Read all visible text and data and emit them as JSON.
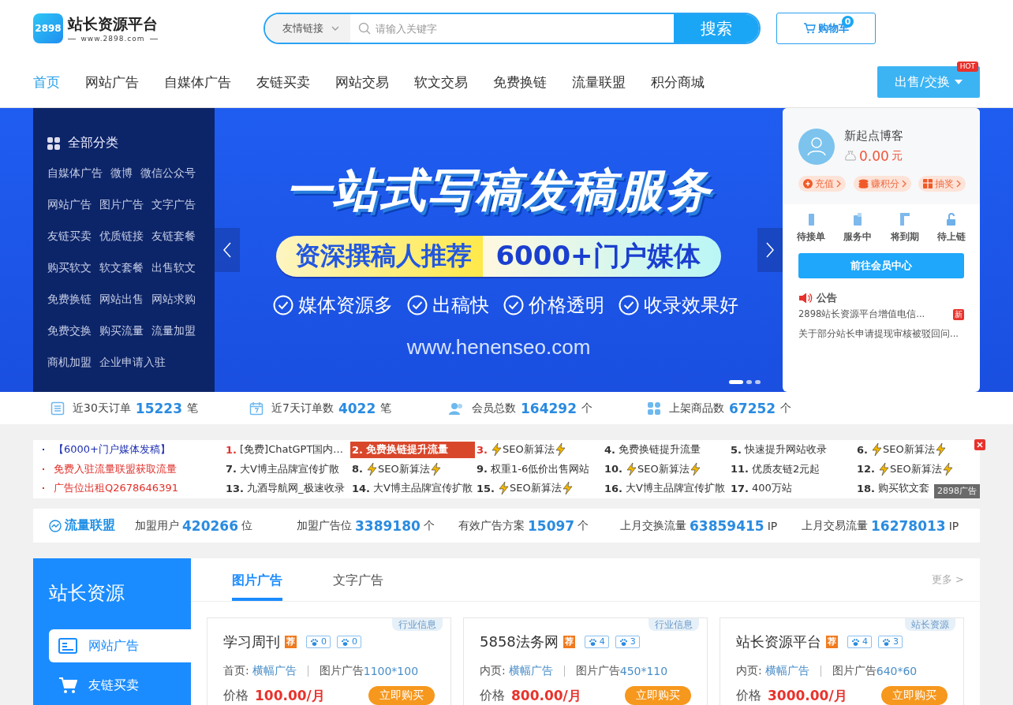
{
  "header": {
    "logo": {
      "badge": "2898",
      "name": "站长资源平台",
      "url": "www.2898.com"
    },
    "search": {
      "category": "友情链接",
      "placeholder": "请输入关键字",
      "button": "搜索"
    },
    "cart": {
      "label": "购物车",
      "count": "0"
    }
  },
  "nav": {
    "items": [
      {
        "label": "首页",
        "selected": true
      },
      {
        "label": "网站广告",
        "selected": false
      },
      {
        "label": "自媒体广告",
        "selected": false
      },
      {
        "label": "友链买卖",
        "selected": false
      },
      {
        "label": "网站交易",
        "selected": false
      },
      {
        "label": "软文交易",
        "selected": false
      },
      {
        "label": "免费换链",
        "selected": false
      },
      {
        "label": "流量联盟",
        "selected": false
      },
      {
        "label": "积分商城",
        "selected": false
      }
    ],
    "action": {
      "label": "出售/交换",
      "badge": "HOT"
    }
  },
  "categories": {
    "title": "全部分类",
    "rows": [
      [
        "自媒体广告",
        "微博",
        "微信公众号"
      ],
      [
        "网站广告",
        "图片广告",
        "文字广告"
      ],
      [
        "友链买卖",
        "优质链接",
        "友链套餐"
      ],
      [
        "购买软文",
        "软文套餐",
        "出售软文"
      ],
      [
        "免费换链",
        "网站出售",
        "网站求购"
      ],
      [
        "免费交换",
        "购买流量",
        "流量加盟"
      ],
      [
        "商机加盟",
        "企业申请入驻"
      ]
    ]
  },
  "banner": {
    "title": "一站式写稿发稿服务",
    "pill_left": "资深撰稿人推荐",
    "pill_right": "6000+门户媒体",
    "features": [
      "媒体资源多",
      "出稿快",
      "价格透明",
      "收录效果好"
    ],
    "url": "www.henenseo.com",
    "slides": [
      {
        "selected": true
      },
      {
        "selected": false
      },
      {
        "selected": false
      }
    ]
  },
  "user_card": {
    "name": "新起点博客",
    "balance": "0.00",
    "currency": "元",
    "actions": [
      {
        "label": "充值",
        "kind": "recharge"
      },
      {
        "label": "赚积分",
        "kind": "points"
      },
      {
        "label": "抽奖",
        "kind": "lottery"
      }
    ],
    "orders": [
      {
        "label": "待接单",
        "kind": "pending"
      },
      {
        "label": "服务中",
        "kind": "serving"
      },
      {
        "label": "将到期",
        "kind": "expiring"
      },
      {
        "label": "待上链",
        "kind": "linking"
      }
    ],
    "button": "前往会员中心",
    "notice": {
      "title": "公告",
      "items": [
        {
          "text": "2898站长资源平台增值电信...",
          "badge": "新"
        },
        {
          "text": "关于部分站长申请提现审核被驳回问..."
        }
      ]
    }
  },
  "stats": [
    {
      "kind": "orders",
      "label": "近30天订单",
      "value": "15223",
      "unit": "笔"
    },
    {
      "kind": "calendar",
      "label": "近7天订单数",
      "value": "4022",
      "unit": "笔"
    },
    {
      "kind": "members",
      "label": "会员总数",
      "value": "164292",
      "unit": "个"
    },
    {
      "kind": "goods",
      "label": "上架商品数",
      "value": "67252",
      "unit": "个"
    }
  ],
  "ticker": {
    "pinned": [
      {
        "text": "【6000+门户媒体发稿】",
        "color": "#1c2fb0"
      },
      {
        "text": "免费入驻流量联盟获取流量",
        "color": "#e0302a"
      },
      {
        "text": "广告位出租Q2678646391",
        "color": "#e0302a"
      }
    ],
    "items": [
      {
        "num": "1.",
        "text": "[免费]ChatGPT国内...",
        "hot": true,
        "highlighted": false,
        "bolts": false
      },
      {
        "num": "2.",
        "text": "免费换链提升流量",
        "hot": true,
        "highlighted": true,
        "bolts": false
      },
      {
        "num": "3.",
        "text": "SEO新算法",
        "hot": true,
        "highlighted": false,
        "bolts": true
      },
      {
        "num": "4.",
        "text": "免费换链提升流量",
        "hot": false,
        "highlighted": false,
        "bolts": false
      },
      {
        "num": "5.",
        "text": "快速提升网站收录",
        "hot": false,
        "highlighted": false,
        "bolts": false
      },
      {
        "num": "6.",
        "text": "SEO新算法",
        "hot": false,
        "highlighted": false,
        "bolts": true
      },
      {
        "num": "7.",
        "text": "大V博主品牌宣传扩散",
        "hot": false,
        "highlighted": false,
        "bolts": false
      },
      {
        "num": "8.",
        "text": "SEO新算法",
        "hot": false,
        "highlighted": false,
        "bolts": true
      },
      {
        "num": "9.",
        "text": "权重1-6低价出售网站",
        "hot": false,
        "highlighted": false,
        "bolts": false
      },
      {
        "num": "10.",
        "text": "SEO新算法",
        "hot": false,
        "highlighted": false,
        "bolts": true
      },
      {
        "num": "11.",
        "text": "优质友链2元起",
        "hot": false,
        "highlighted": false,
        "bolts": false
      },
      {
        "num": "12.",
        "text": "SEO新算法",
        "hot": false,
        "highlighted": false,
        "bolts": true
      },
      {
        "num": "13.",
        "text": "九酒导航网_极速收录",
        "hot": false,
        "highlighted": false,
        "bolts": false
      },
      {
        "num": "14.",
        "text": "大V博主品牌宣传扩散",
        "hot": false,
        "highlighted": false,
        "bolts": false
      },
      {
        "num": "15.",
        "text": "SEO新算法",
        "hot": false,
        "highlighted": false,
        "bolts": true
      },
      {
        "num": "16.",
        "text": "大V博主品牌宣传扩散",
        "hot": false,
        "highlighted": false,
        "bolts": false
      },
      {
        "num": "17.",
        "text": "400万站",
        "hot": false,
        "highlighted": false,
        "bolts": false
      },
      {
        "num": "18.",
        "text": "购买软文套",
        "hot": false,
        "highlighted": false,
        "bolts": false
      }
    ],
    "badge": "2898广告"
  },
  "alliance": {
    "title": "流量联盟",
    "stats": [
      {
        "label": "加盟用户",
        "value": "420266",
        "unit": "位"
      },
      {
        "label": "加盟广告位",
        "value": "3389180",
        "unit": "个"
      },
      {
        "label": "有效广告方案",
        "value": "15097",
        "unit": "个"
      },
      {
        "label": "上月交换流量",
        "value": "63859415",
        "unit": "IP"
      },
      {
        "label": "上月交易流量",
        "value": "16278013",
        "unit": "IP"
      }
    ]
  },
  "resources": {
    "title": "站长资源",
    "menu": [
      {
        "label": "网站广告",
        "kind": "website-ad",
        "selected": true
      },
      {
        "label": "友链买卖",
        "kind": "links",
        "selected": false
      }
    ],
    "tabs": [
      {
        "label": "图片广告",
        "selected": true
      },
      {
        "label": "文字广告",
        "selected": false
      }
    ],
    "more": "更多 >",
    "cards": [
      {
        "tag": "行业信息",
        "title": "学习周刊",
        "badge": "荐",
        "likes": "0",
        "visits": "0",
        "page": "首页:",
        "position": "横幅广告",
        "format": "图片广告",
        "size": "1100*100",
        "price_label": "价格",
        "price": "100.00/月",
        "buy": "立即购买"
      },
      {
        "tag": "行业信息",
        "title": "5858法务网",
        "badge": "荐",
        "likes": "4",
        "visits": "3",
        "page": "内页:",
        "position": "横幅广告",
        "format": "图片广告",
        "size": "450*110",
        "price_label": "价格",
        "price": "800.00/月",
        "buy": "立即购买"
      },
      {
        "tag": "站长资源",
        "title": "站长资源平台",
        "badge": "荐",
        "likes": "4",
        "visits": "3",
        "page": "内页:",
        "position": "横幅广告",
        "format": "图片广告",
        "size": "640*60",
        "price_label": "价格",
        "price": "3000.00/月",
        "buy": "立即购买"
      }
    ]
  }
}
